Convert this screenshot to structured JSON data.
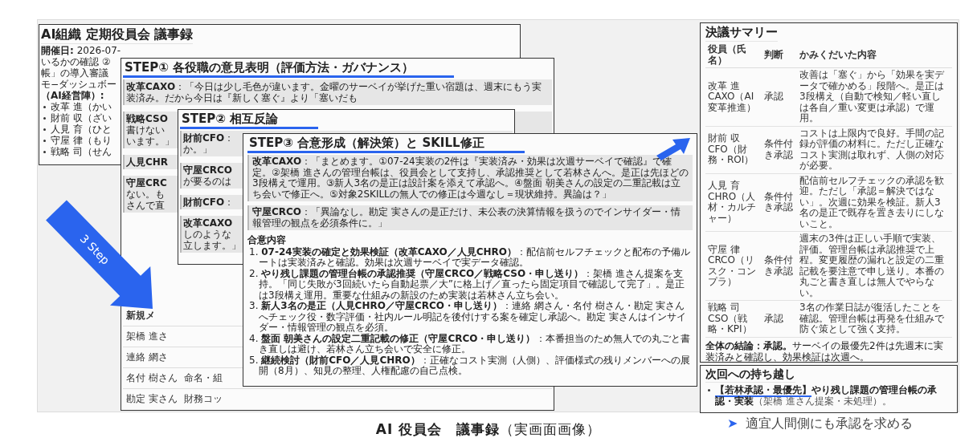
{
  "slide": {
    "caption": "**AI 役員会　議事録**（実画面画像）",
    "windows": [
      {
        "kind": "header",
        "title": "AI組織 定期役員会 議事録",
        "lines": [
          "**開催日:** 2026-07-",
          "いるかの確認 ②",
          "帳」の導入審議",
          "モ−ダッシュボー",
          "**（AI経営陣）:**"
        ],
        "members": [
          "改革 進（かい",
          "財前 収（ざい",
          "人見 育（ひと",
          "守屋 律（もり",
          "戦略 司（せん"
        ]
      },
      {
        "kind": "step",
        "heading": "STEP① 各役職の意見表明（評価方法・ガバナンス）",
        "blocks": [
          {
            "lines": [
              "**改革CAXO**：「今日は少し毛色が違います。金曜のサーベイが挙げた重い宿題は、週末にもう実装済み。だから今日は『新しく塞ぐ』より「塞いだも"
            ]
          },
          {
            "lines": [
              "**戦略CSO**",
              "書けない",
              "います。」"
            ]
          },
          {
            "lines": [
              "**人見CHR**"
            ]
          },
          {
            "lines": [
              "**守屋CRC**",
              "ない。も",
              "さんで直"
            ]
          }
        ],
        "table": {
          "header": "新規メ",
          "rows": [
            [
              "架橋 進さ"
            ],
            [
              "連絡 網さ"
            ],
            [
              "名付 樹さん",
              "命名・組"
            ],
            [
              "勘定 実さん",
              "財務コッ"
            ]
          ]
        }
      },
      {
        "kind": "step",
        "heading": "STEP② 相互反論",
        "blocks": [
          {
            "lines": [
              "**財前CFO**：",
              "か。」"
            ]
          },
          {
            "lines": [
              "**守屋CRCO**",
              "が要るのは"
            ]
          },
          {
            "lines": [
              "**財前CFO**："
            ]
          },
          {
            "lines": [
              "**改革CAXO**",
              "しのような",
              "立します。」"
            ]
          }
        ]
      },
      {
        "kind": "step",
        "heading": "STEP③ 合意形成（解決策）と SKILL修正",
        "blocks": [
          {
            "lines": [
              "**改革CAXO**：「まとめます。①07-24実装の2件は『実装済み・効果は次週サーベイで確認』で確定。②架橋 進さんの管理台帳は、役員会として支持し、承認推奨として若林さんへ。是正は先ほどの3段構えで運用。③新人3名の是正は設計案を添えて承認へ。④盤面 朝美さんの設定の二重記載は立ち会いで修正へ。⑤対象2SKILLの無人での修正は今週なし＝現状維持。異論は？」"
            ]
          },
          {
            "lines": [
              "**守屋CRCO**：「異論なし。勘定 実さんの是正だけ、未公表の決算情報を扱うのでインサイダー・情報管理の観点を必須条件に。」"
            ]
          }
        ],
        "agreement": {
          "label": "合意内容",
          "items": [
            "1. **07-24実装の確定と効果検証（改革CAXO／人見CHRO）**：配信前セルフチェックと配布の予備ルートは実装済みと確認。効果は次週サーベイで実データ確認。",
            "2. **やり残し課題の管理台帳の承認推奨（守屋CRCO／戦略CSO・申し送り）**：架橋 進さん提案を支持。「同じ失敗が3回続いたら自動起票／大”に格上げ／直ったら固定項目で確認して完了」。是正は3段構え運用。重要な仕組みの新設のため実装は若林さん立ち会い。",
            "3. **新人3名の是正（人見CHRO／守屋CRCO・申し送り）**：連絡 網さん・名付 樹さん・勘定 実さんへチェック役・数字評価・社内ルール明記を後付けする案を確定し承認へ。勘定 実さんはインサイダー・情報管理の観点を必須。",
            "4. **盤面 朝美さんの設定二重記載の修正（守屋CRCO・申し送り）**：本番担当のため無人での丸ごと書き直しは避け、若林さん立ち会いで安全に修正。",
            "5. **継続検討（財前CFO／人見CHRO）**：正確なコスト実測（人側）、評価様式の残りメンバーへの展開（8月）、知見の整理、人権配慮の自己点検。"
          ]
        }
      },
      {
        "kind": "summary",
        "title": "決議サマリー",
        "columns": [
          "役員（氏名）",
          "判断",
          "かみくだいた内容"
        ],
        "rows": [
          [
            "改革 進 CAXO（AI変革推進）",
            "承認",
            "改善は「塞ぐ」から「効果を実データで確かめる」段階へ。是正は3段構え（自動で検知／軽い直しは各自／重い変更は承認）で運用。"
          ],
          [
            "財前 収 CFO（財務・ROI）",
            "条件付き承認",
            "コストは上限内で良好。手間の記録が評価の材料に。ただし正確なコスト実測は取れず、人側の対応が必要。"
          ],
          [
            "人見 育 CHRO（人材・カルチャー）",
            "条件付き承認",
            "配信前セルフチェックの承認を歓迎。ただし「承認＝解決ではない」。次週に効果を検証。新人3名の是正で既存を置き去りにしないこと。"
          ],
          [
            "守屋 律 CRCO（リスク・コンプラ）",
            "条件付き承認",
            "週末の3件は正しい手順で実装、評価。管理台帳は承認推奨で上程。変更履歴の漏れと設定の二重記載を要注意で申し送り。本番の丸ごと書き直しは無人でやらない。"
          ],
          [
            "戦略 司 CSO（戦略・KPI）",
            "承認",
            "3名の作業日誌が復活したことを確認。管理台帳は再発を仕組みで防ぐ策として強く支持。"
          ]
        ],
        "conclusion": "**全体の結論：承認。**サーベイの最優先2件は先週末に実装済みと確認し、効果検証は次週へ。"
      },
      {
        "kind": "carryover",
        "title": "次回への持ち越し",
        "items": [
          {
            "tag": "【若林承認・最優先】",
            "title": "やり残し課題の管理台帳の承認・実装",
            "note": "（架橋 進さん提案・未処理）。"
          }
        ]
      }
    ],
    "arrow_label": "3 Step",
    "note": {
      "marker": "➤",
      "text": "適宜人間側にも承認を求める"
    }
  }
}
